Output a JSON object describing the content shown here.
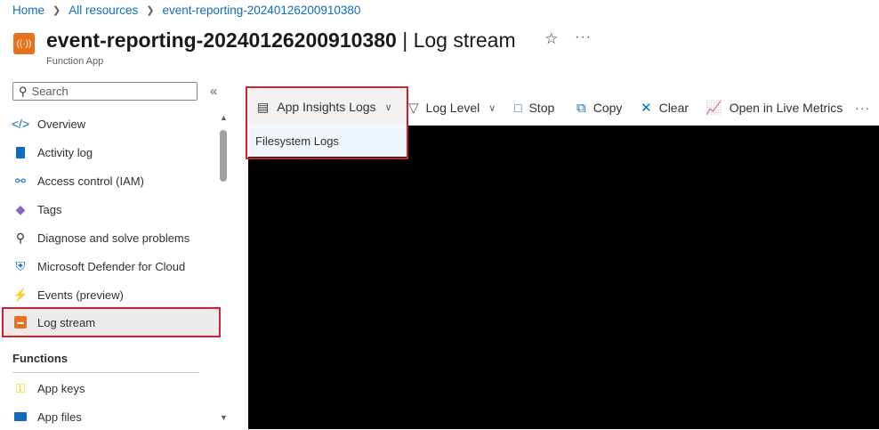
{
  "breadcrumb": [
    "Home",
    "All resources",
    "event-reporting-20240126200910380"
  ],
  "header": {
    "resource_name": "event-reporting-20240126200910380",
    "separator": "|",
    "page": "Log stream",
    "subtitle": "Function App",
    "app_icon_glyph": "((·))"
  },
  "search": {
    "placeholder": "Search"
  },
  "sidebar": {
    "items": [
      {
        "label": "Overview",
        "icon": "overview-icon"
      },
      {
        "label": "Activity log",
        "icon": "activity-log-icon"
      },
      {
        "label": "Access control (IAM)",
        "icon": "access-control-icon"
      },
      {
        "label": "Tags",
        "icon": "tag-icon"
      },
      {
        "label": "Diagnose and solve problems",
        "icon": "wrench-icon"
      },
      {
        "label": "Microsoft Defender for Cloud",
        "icon": "shield-icon"
      },
      {
        "label": "Events (preview)",
        "icon": "lightning-icon"
      },
      {
        "label": "Log stream",
        "icon": "log-stream-icon",
        "active": true
      }
    ],
    "functions_section": "Functions",
    "function_items": [
      {
        "label": "App keys",
        "icon": "key-icon"
      },
      {
        "label": "App files",
        "icon": "app-files-icon"
      }
    ]
  },
  "toolbar": {
    "log_source": {
      "selected": "App Insights Logs",
      "options": [
        "Filesystem Logs"
      ]
    },
    "log_level": "Log Level",
    "stop": "Stop",
    "copy": "Copy",
    "clear": "Clear",
    "live_metrics": "Open in Live Metrics"
  },
  "colors": {
    "accent": "#0f6cbd",
    "highlight_outline": "#d3202f",
    "console_bg": "#000000",
    "app_icon": "#e8711c"
  }
}
